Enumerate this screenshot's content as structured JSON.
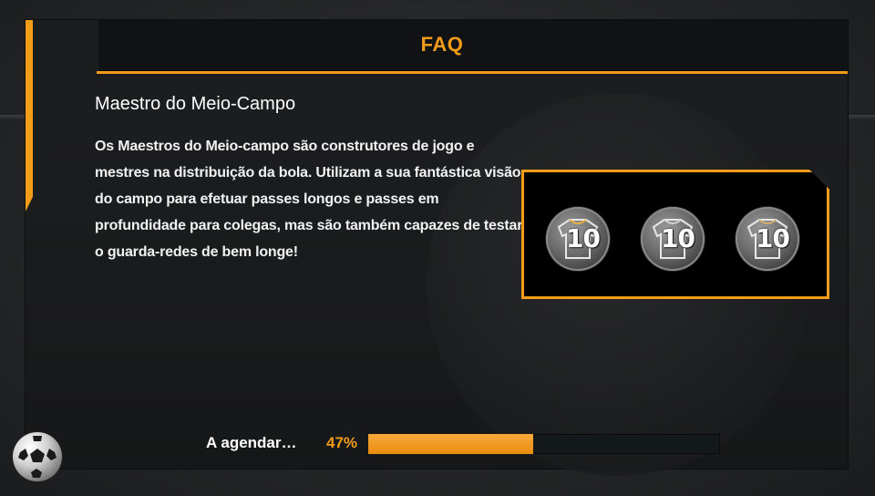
{
  "dialog": {
    "title": "FAQ",
    "heading": "Maestro do Meio-Campo",
    "description": "Os Maestros do Meio-campo são construtores de jogo e mestres na distribuição da bola. Utilizam a sua fantástica visão do campo para efetuar passes longos e passes em profundidade para colegas, mas são também capazes de testar o guarda-redes de bem longe!",
    "badges": [
      {
        "number": "10",
        "icon": "jersey-10-badge-icon"
      },
      {
        "number": "10",
        "icon": "jersey-10-badge-icon"
      },
      {
        "number": "10",
        "icon": "jersey-10-badge-icon"
      }
    ]
  },
  "loading": {
    "label": "A agendar…",
    "percent_text": "47%",
    "progress": 0.47,
    "spinner_icon": "soccer-ball-icon"
  },
  "colors": {
    "accent": "#f39c1a",
    "panel": "#1c1d1e",
    "badge_box": "#000000"
  }
}
